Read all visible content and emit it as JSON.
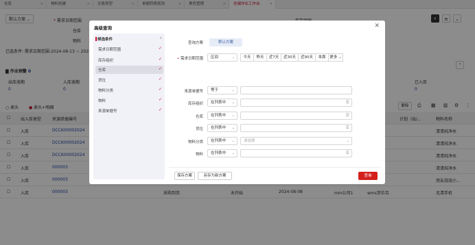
{
  "tabs": [
    {
      "label": "仓库"
    },
    {
      "label": "物料创建"
    },
    {
      "label": "交易类型"
    },
    {
      "label": "单据转换规则"
    },
    {
      "label": "角色管理"
    },
    {
      "label": "仓储作业工作台"
    }
  ],
  "bg": {
    "scheme": "默认方案",
    "need_date": "需求日期范围",
    "warehouse": "仓库",
    "material": "物料",
    "selected": "已选条件: 需求日期范围:2024-08-13 ~ 2024",
    "inventory_org": "库存组织",
    "warning": "作业预警",
    "warning_count": "0",
    "out_overdue": "出库逾期",
    "out_overdue_n": "0",
    "in_overdue": "入库逾期",
    "in_overdue_n": "0",
    "entered": "已入库",
    "entered_n": "0",
    "opt_header": "表头",
    "opt_detail": "表头+明细",
    "delete": "删除",
    "material_name": "物料名称",
    "plan": "计划（出/...",
    "col_type": "出入库类型",
    "col_source": "来源单据编号",
    "rows": [
      {
        "type": "入库",
        "code": "DCCK00002024",
        "name": "清清纯净水"
      },
      {
        "type": "入库",
        "code": "DCCK00002024",
        "name": "清清纯净水"
      },
      {
        "type": "入库",
        "code": "DCCK00002024",
        "name": "清清纯净水"
      },
      {
        "type": "入库",
        "code": "000003",
        "name": "清清纯净水"
      },
      {
        "type": "入库",
        "code": "000003",
        "name": "用友烧烧小..."
      },
      {
        "type": "入库",
        "code": "000003",
        "name": "北清手机"
      }
    ],
    "last_row_purchase": "采购到货",
    "last_row_status": "未开始",
    "last_row_date": "2024-08-08",
    "last_row_wh": "mm公司1",
    "last_row_loc": "wms货位合"
  },
  "modal": {
    "title": "高级查询",
    "left_title": "候选条件",
    "fields": [
      {
        "label": "需求日期范围",
        "checked": true
      },
      {
        "label": "库存组织",
        "checked": true
      },
      {
        "label": "仓库",
        "checked": true
      },
      {
        "label": "货位",
        "checked": true
      },
      {
        "label": "物料分类",
        "checked": true
      },
      {
        "label": "物料",
        "checked": true
      },
      {
        "label": "来源单据号",
        "checked": true
      }
    ],
    "scheme_label": "查询方案",
    "scheme_value": "默认方案",
    "rows": [
      {
        "label": "需求日期范围",
        "op": "区间",
        "required": true
      },
      {
        "label": "来源单据号",
        "op": "等于"
      },
      {
        "label": "库存组织",
        "op": "在列表中"
      },
      {
        "label": "仓库",
        "op": "在列表中"
      },
      {
        "label": "货位",
        "op": "在列表中"
      },
      {
        "label": "物料分类",
        "op": "在列表中",
        "placeholder": "请选择"
      },
      {
        "label": "物料",
        "op": "在列表中"
      }
    ],
    "quick": [
      "今天",
      "昨天",
      "近7天",
      "近30天",
      "近90天",
      "本周",
      "更多"
    ],
    "save": "保存方案",
    "save_as": "另存为新方案",
    "query": "查询"
  }
}
